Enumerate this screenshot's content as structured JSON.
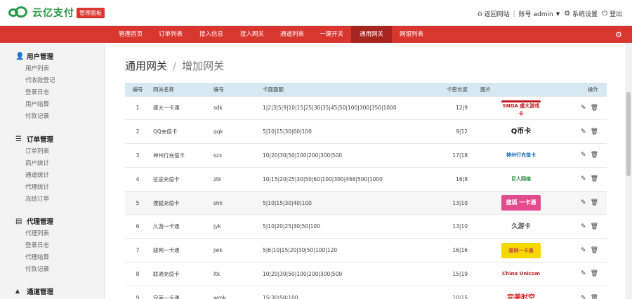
{
  "header": {
    "logo_text": "云亿支付",
    "badge": "管理面板",
    "links": {
      "home": "返回网站",
      "account": "账号 admin",
      "settings": "系统设置",
      "logout": "登出"
    }
  },
  "nav": {
    "tabs": [
      "管理首页",
      "订单列表",
      "接入信息",
      "接入网关",
      "通道列表",
      "一键开关",
      "通用网关",
      "网银列表"
    ],
    "active_index": 6
  },
  "sidebar": {
    "groups": [
      {
        "title": "用户管理",
        "icon": "user-icon",
        "items": [
          "用户列表",
          "代收款登记",
          "登录日志",
          "用户结算",
          "付款记录"
        ]
      },
      {
        "title": "订单管理",
        "icon": "list-icon",
        "items": [
          "订单列表",
          "商户统计",
          "通道统计",
          "代理统计",
          "冻结订单"
        ]
      },
      {
        "title": "代理管理",
        "icon": "file-icon",
        "items": [
          "代理列表",
          "登录日志",
          "代理结算",
          "付款记录"
        ]
      },
      {
        "title": "通道管理",
        "icon": "road-icon",
        "items": []
      }
    ]
  },
  "breadcrumb": {
    "main": "通用网关",
    "sub": "增加网关"
  },
  "table": {
    "headers": [
      "编号",
      "网关名称",
      "编号",
      "卡面面额",
      "卡密长度",
      "图片",
      "操作"
    ],
    "rows": [
      {
        "idx": "1",
        "name": "盛大一卡通",
        "code": "sdk",
        "denom": "1|2|3|5|9|10|15|25|30|35|45|50|100|300|350|1000",
        "len": "12|9",
        "logo": "SNDA 盛大游戏卡"
      },
      {
        "idx": "2",
        "name": "QQ充值卡",
        "code": "qqk",
        "denom": "5|10|15|30|60|100",
        "len": "9|12",
        "logo": "Q币卡"
      },
      {
        "idx": "3",
        "name": "神州行充值卡",
        "code": "szx",
        "denom": "10|20|30|50|100|200|300|500",
        "len": "17|18",
        "logo": "神州行充值卡"
      },
      {
        "idx": "4",
        "name": "征途充值卡",
        "code": "ztk",
        "denom": "10|15|20|25|30|50|60|100|300|468|500|1000",
        "len": "16|8",
        "logo": "巨人网络"
      },
      {
        "idx": "5",
        "name": "搜狐充值卡",
        "code": "shk",
        "denom": "5|10|15|30|40|100",
        "len": "13|10",
        "logo": "搜狐 一卡通"
      },
      {
        "idx": "6",
        "name": "久游一卡通",
        "code": "jyk",
        "denom": "5|10|20|25|30|50|100",
        "len": "13|10",
        "logo": "久游卡"
      },
      {
        "idx": "7",
        "name": "骏网一卡通",
        "code": "jwk",
        "denom": "5|6|10|15|20|30|50|100|120",
        "len": "16|16",
        "logo": "骏网一卡通"
      },
      {
        "idx": "8",
        "name": "联通充值卡",
        "code": "ltk",
        "denom": "10|20|30|50|100|200|300|500",
        "len": "15|19",
        "logo": "China Unicom"
      },
      {
        "idx": "9",
        "name": "完美一卡通",
        "code": "wmk",
        "denom": "15|30|50|100",
        "len": "10|15",
        "logo": "完美时空"
      }
    ]
  },
  "colors": {
    "accent": "#d9362f",
    "accent_dark": "#a8241f",
    "brand_green": "#2a9a4a",
    "table_head": "#d6e8f2"
  }
}
